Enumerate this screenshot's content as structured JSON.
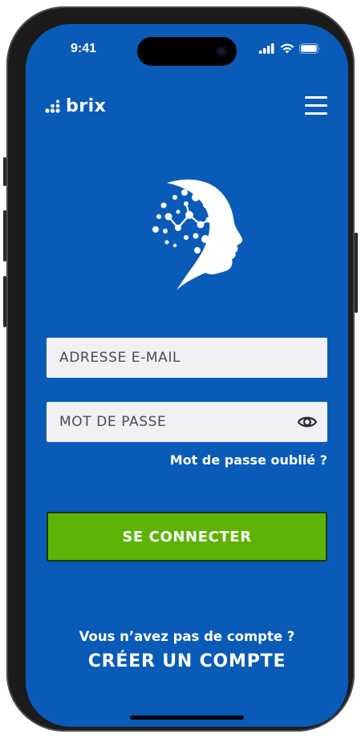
{
  "status_bar": {
    "time": "9:41",
    "icons": [
      "cellular-signal-icon",
      "wifi-icon",
      "battery-icon"
    ]
  },
  "header": {
    "brand_name": "brix",
    "logo_icon": "dots-logo-icon",
    "menu_icon": "hamburger-menu-icon"
  },
  "hero": {
    "icon": "brain-network-head-icon"
  },
  "form": {
    "email_placeholder": "ADRESSE E-MAIL",
    "password_placeholder": "MOT DE PASSE",
    "eye_icon": "eye-icon",
    "forgot_label": "Mot de passe oublié ?",
    "login_label": "SE CONNECTER"
  },
  "footer": {
    "no_account_text": "Vous n’avez pas de compte ?",
    "create_account_label": "CRÉER UN COMPTE"
  },
  "colors": {
    "background": "#0a5bb8",
    "button": "#5db304",
    "field": "#f1f0f4",
    "text": "#ffffff"
  }
}
